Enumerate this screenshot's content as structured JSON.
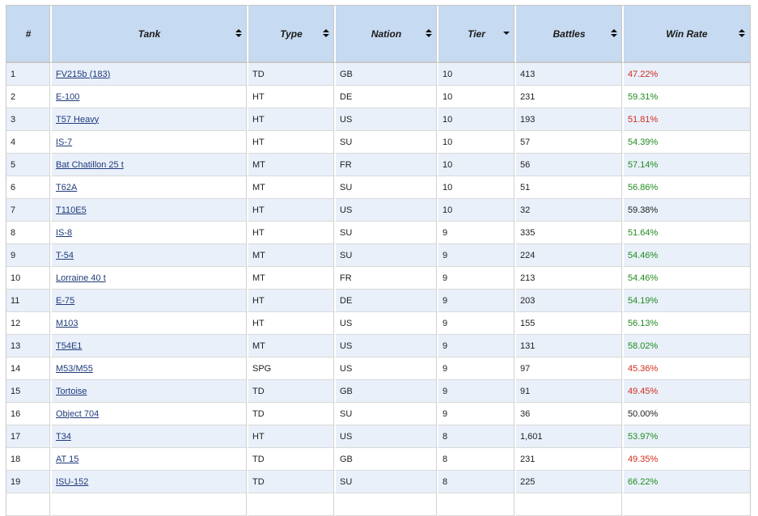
{
  "colors": {
    "header_bg": "#c6daf1",
    "row_alt_bg": "#e9f0fa",
    "link": "#1f3a7a",
    "win_green": "#1f8a1f",
    "win_red": "#d22b1d"
  },
  "headers": {
    "num": "#",
    "tank": "Tank",
    "type": "Type",
    "nation": "Nation",
    "tier": "Tier",
    "battles": "Battles",
    "winrate": "Win Rate"
  },
  "rows": [
    {
      "num": "1",
      "tank": "FV215b (183)",
      "type": "TD",
      "nation": "GB",
      "tier": "10",
      "battles": "413",
      "winrate": "47.22%",
      "wr_class": "red"
    },
    {
      "num": "2",
      "tank": "E-100",
      "type": "HT",
      "nation": "DE",
      "tier": "10",
      "battles": "231",
      "winrate": "59.31%",
      "wr_class": "green"
    },
    {
      "num": "3",
      "tank": "T57 Heavy",
      "type": "HT",
      "nation": "US",
      "tier": "10",
      "battles": "193",
      "winrate": "51.81%",
      "wr_class": "red"
    },
    {
      "num": "4",
      "tank": "IS-7",
      "type": "HT",
      "nation": "SU",
      "tier": "10",
      "battles": "57",
      "winrate": "54.39%",
      "wr_class": "green"
    },
    {
      "num": "5",
      "tank": "Bat Chatillon 25 t",
      "type": "MT",
      "nation": "FR",
      "tier": "10",
      "battles": "56",
      "winrate": "57.14%",
      "wr_class": "green"
    },
    {
      "num": "6",
      "tank": "T62A",
      "type": "MT",
      "nation": "SU",
      "tier": "10",
      "battles": "51",
      "winrate": "56.86%",
      "wr_class": "green"
    },
    {
      "num": "7",
      "tank": "T110E5",
      "type": "HT",
      "nation": "US",
      "tier": "10",
      "battles": "32",
      "winrate": "59.38%",
      "wr_class": "neutral"
    },
    {
      "num": "8",
      "tank": "IS-8",
      "type": "HT",
      "nation": "SU",
      "tier": "9",
      "battles": "335",
      "winrate": "51.64%",
      "wr_class": "green"
    },
    {
      "num": "9",
      "tank": "T-54",
      "type": "MT",
      "nation": "SU",
      "tier": "9",
      "battles": "224",
      "winrate": "54.46%",
      "wr_class": "green"
    },
    {
      "num": "10",
      "tank": "Lorraine 40 t",
      "type": "MT",
      "nation": "FR",
      "tier": "9",
      "battles": "213",
      "winrate": "54.46%",
      "wr_class": "green"
    },
    {
      "num": "11",
      "tank": "E-75",
      "type": "HT",
      "nation": "DE",
      "tier": "9",
      "battles": "203",
      "winrate": "54.19%",
      "wr_class": "green"
    },
    {
      "num": "12",
      "tank": "M103",
      "type": "HT",
      "nation": "US",
      "tier": "9",
      "battles": "155",
      "winrate": "56.13%",
      "wr_class": "green"
    },
    {
      "num": "13",
      "tank": "T54E1",
      "type": "MT",
      "nation": "US",
      "tier": "9",
      "battles": "131",
      "winrate": "58.02%",
      "wr_class": "green"
    },
    {
      "num": "14",
      "tank": "M53/M55",
      "type": "SPG",
      "nation": "US",
      "tier": "9",
      "battles": "97",
      "winrate": "45.36%",
      "wr_class": "red"
    },
    {
      "num": "15",
      "tank": "Tortoise",
      "type": "TD",
      "nation": "GB",
      "tier": "9",
      "battles": "91",
      "winrate": "49.45%",
      "wr_class": "red"
    },
    {
      "num": "16",
      "tank": "Object 704",
      "type": "TD",
      "nation": "SU",
      "tier": "9",
      "battles": "36",
      "winrate": "50.00%",
      "wr_class": "neutral"
    },
    {
      "num": "17",
      "tank": "T34",
      "type": "HT",
      "nation": "US",
      "tier": "8",
      "battles": "1,601",
      "winrate": "53.97%",
      "wr_class": "green"
    },
    {
      "num": "18",
      "tank": "AT 15",
      "type": "TD",
      "nation": "GB",
      "tier": "8",
      "battles": "231",
      "winrate": "49.35%",
      "wr_class": "red"
    },
    {
      "num": "19",
      "tank": "ISU-152",
      "type": "TD",
      "nation": "SU",
      "tier": "8",
      "battles": "225",
      "winrate": "66.22%",
      "wr_class": "green"
    },
    {
      "num": "",
      "tank": "",
      "type": "",
      "nation": "",
      "tier": "",
      "battles": "",
      "winrate": "",
      "wr_class": "neutral"
    }
  ]
}
